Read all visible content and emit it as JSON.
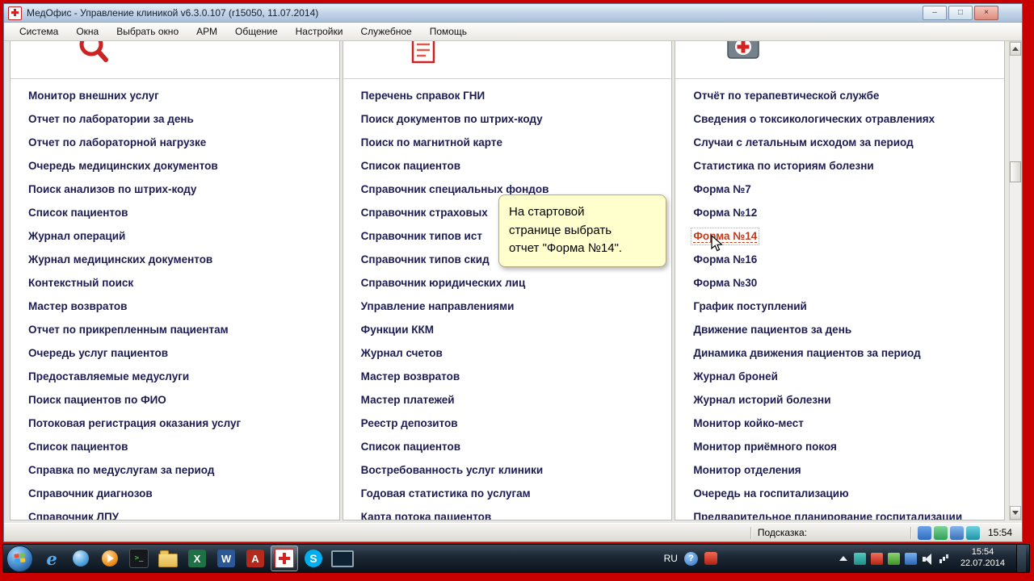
{
  "window": {
    "title": "МедОфис - Управление клиникой v6.3.0.107 (r15050, 11.07.2014)",
    "controls": {
      "minimize": "–",
      "maximize": "□",
      "close": "×"
    }
  },
  "menu": {
    "items": [
      {
        "label": "Система",
        "name": "menu-system"
      },
      {
        "label": "Окна",
        "name": "menu-windows"
      },
      {
        "label": "Выбрать окно",
        "name": "menu-select-window"
      },
      {
        "label": "АРМ",
        "name": "menu-arm"
      },
      {
        "label": "Общение",
        "name": "menu-communication"
      },
      {
        "label": "Настройки",
        "name": "menu-settings"
      },
      {
        "label": "Служебное",
        "name": "menu-service"
      },
      {
        "label": "Помощь",
        "name": "menu-help"
      }
    ]
  },
  "panels": [
    {
      "items": [
        {
          "label": "Монитор внешних услуг"
        },
        {
          "label": "Отчет по лаборатории за день"
        },
        {
          "label": "Отчет по лабораторной нагрузке"
        },
        {
          "label": "Очередь медицинских документов"
        },
        {
          "label": "Поиск анализов по штрих-коду"
        },
        {
          "label": "Список пациентов"
        },
        {
          "label": "Журнал операций"
        },
        {
          "label": "Журнал медицинских документов"
        },
        {
          "label": "Контекстный поиск"
        },
        {
          "label": "Мастер возвратов"
        },
        {
          "label": "Отчет по прикрепленным пациентам"
        },
        {
          "label": "Очередь услуг пациентов"
        },
        {
          "label": "Предоставляемые медуслуги"
        },
        {
          "label": "Поиск пациентов по ФИО"
        },
        {
          "label": "Потоковая регистрация оказания услуг"
        },
        {
          "label": "Список пациентов"
        },
        {
          "label": "Справка по медуслугам за период"
        },
        {
          "label": "Справочник диагнозов"
        },
        {
          "label": "Справочник ЛПУ"
        }
      ]
    },
    {
      "items": [
        {
          "label": "Перечень справок ГНИ"
        },
        {
          "label": "Поиск документов по штрих-коду"
        },
        {
          "label": "Поиск по магнитной карте"
        },
        {
          "label": "Список пациентов"
        },
        {
          "label": "Справочник специальных фондов"
        },
        {
          "label": "Справочник страховых"
        },
        {
          "label": "Справочник типов ист"
        },
        {
          "label": "Справочник типов скид"
        },
        {
          "label": "Справочник юридических лиц"
        },
        {
          "label": "Управление направлениями"
        },
        {
          "label": "Функции ККМ"
        },
        {
          "label": "Журнал счетов"
        },
        {
          "label": "Мастер возвратов"
        },
        {
          "label": "Мастер платежей"
        },
        {
          "label": "Реестр депозитов"
        },
        {
          "label": "Список пациентов"
        },
        {
          "label": "Востребованность услуг клиники"
        },
        {
          "label": "Годовая статистика по услугам"
        },
        {
          "label": "Карта потока пациентов"
        }
      ]
    },
    {
      "items": [
        {
          "label": "Отчёт по терапевтической службе"
        },
        {
          "label": "Сведения о токсикологических отравлениях"
        },
        {
          "label": "Случаи с летальным исходом за период"
        },
        {
          "label": "Статистика по историям болезни"
        },
        {
          "label": "Форма №7"
        },
        {
          "label": "Форма №12"
        },
        {
          "label": "Форма №14",
          "class": "highlight",
          "name": "link-forma-14"
        },
        {
          "label": "Форма №16"
        },
        {
          "label": "Форма №30"
        },
        {
          "label": "График поступлений"
        },
        {
          "label": "Движение пациентов за день"
        },
        {
          "label": "Динамика движения пациентов за период"
        },
        {
          "label": "Журнал броней"
        },
        {
          "label": "Журнал историй болезни"
        },
        {
          "label": "Монитор койко-мест"
        },
        {
          "label": "Монитор приёмного покоя"
        },
        {
          "label": "Монитор отделения"
        },
        {
          "label": "Очередь на госпитализацию"
        },
        {
          "label": "Предварительное планирование госпитализации"
        }
      ]
    }
  ],
  "tooltip": {
    "text": "На стартовой\nстранице выбрать\nотчет \"Форма №14\"."
  },
  "statusbar": {
    "hint_label": "Подсказка:",
    "time": "15:54"
  },
  "taskbar": {
    "icons": [
      {
        "name": "internet-explorer-icon",
        "glyph": "e",
        "class": "ic-ie"
      },
      {
        "name": "browser-icon",
        "glyph": "",
        "class": "ic-globe"
      },
      {
        "name": "media-player-icon",
        "glyph": "",
        "class": "ic-media"
      },
      {
        "name": "terminal-icon",
        "glyph": ">_",
        "class": "ic-term"
      },
      {
        "name": "explorer-folder-icon",
        "glyph": "",
        "class": "ic-folder"
      },
      {
        "name": "excel-icon",
        "glyph": "X",
        "class": "ic-excel"
      },
      {
        "name": "word-icon",
        "glyph": "W",
        "class": "ic-word"
      },
      {
        "name": "acrobat-icon",
        "glyph": "A",
        "class": "ic-pdf"
      },
      {
        "name": "medoffice-icon",
        "glyph": "",
        "class": "ic-med active"
      },
      {
        "name": "skype-icon",
        "glyph": "S",
        "class": "ic-skype"
      },
      {
        "name": "remote-desktop-icon",
        "glyph": "",
        "class": "ic-rdp"
      }
    ],
    "tray": {
      "language": "RU",
      "help_glyph": "?",
      "icons": [
        {
          "name": "hidden-icons-button",
          "class": "tr-arrow"
        },
        {
          "name": "tray-app-icon-1",
          "class": "tr-teal"
        },
        {
          "name": "tray-app-icon-2",
          "class": "tr-red"
        },
        {
          "name": "tray-app-icon-3",
          "class": "tr-green"
        },
        {
          "name": "tray-app-icon-4",
          "class": "tr-blue"
        },
        {
          "name": "volume-icon",
          "class": "tr-vol"
        },
        {
          "name": "network-icon",
          "class": "tr-net"
        }
      ],
      "time": "15:54",
      "date": "22.07.2014"
    }
  }
}
